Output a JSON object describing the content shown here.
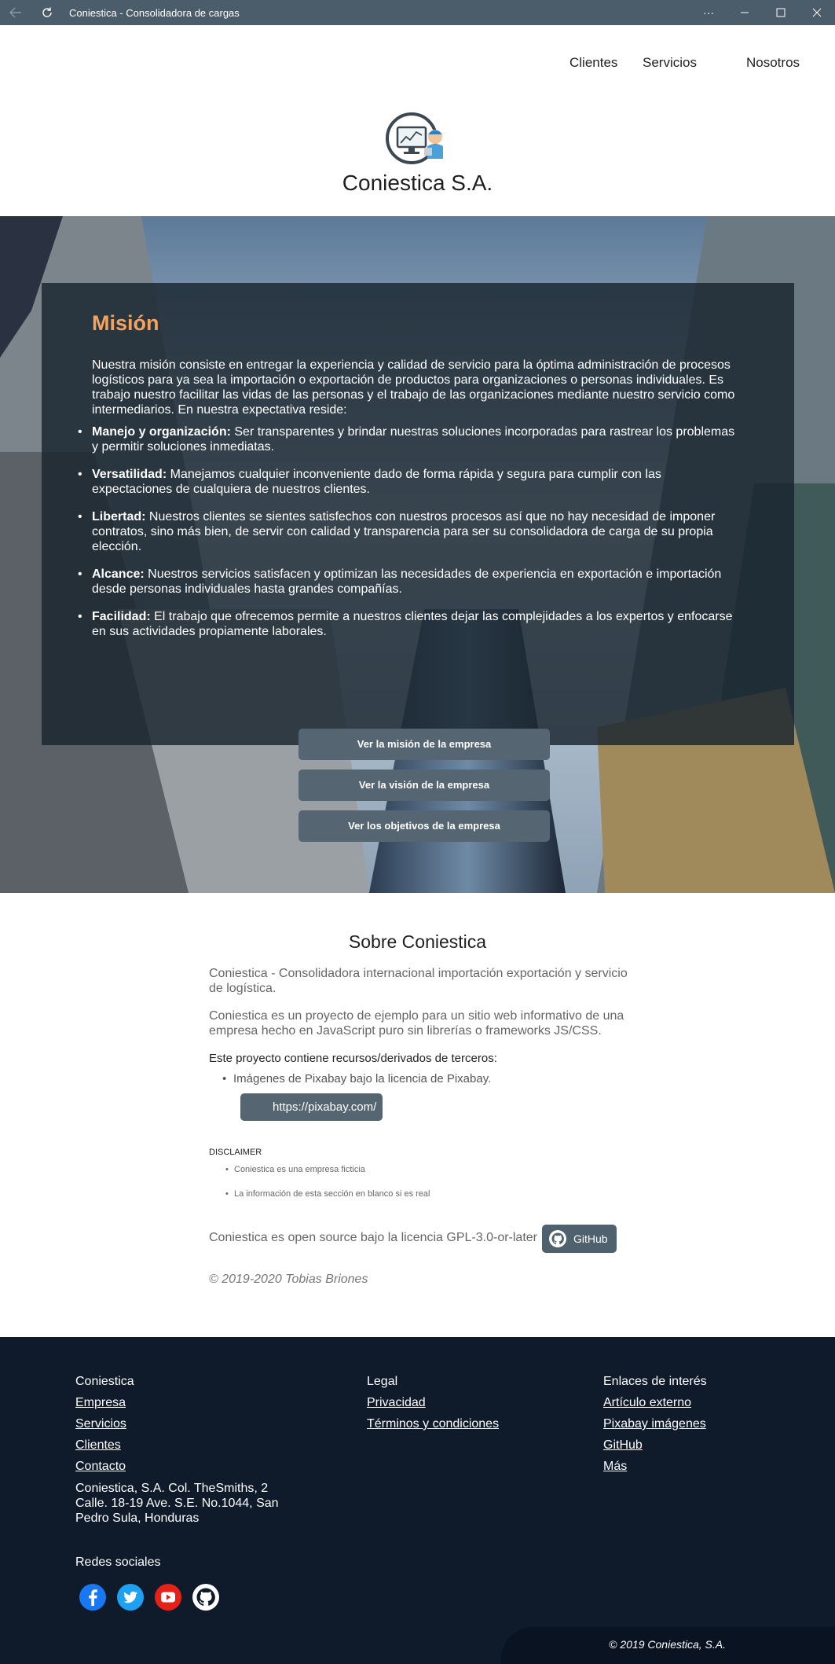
{
  "window": {
    "title": "Coniestica - Consolidadora de cargas",
    "more_label": "···",
    "minimize_label": "—",
    "maximize_label": "☐",
    "close_label": "✕"
  },
  "nav": {
    "clientes": "Clientes",
    "servicios": "Servicios",
    "nosotros": "Nosotros"
  },
  "brand": "Coniestica S.A.",
  "mission": {
    "title": "Misión",
    "intro": "Nuestra misión consiste en entregar la experiencia y calidad de servicio para la óptima administración de procesos logísticos para ya sea la importación o exportación de productos para organizaciones o personas individuales. Es trabajo nuestro facilitar las vidas de las personas y el trabajo de las organizaciones mediante nuestro servicio como intermediarios. En nuestra expectativa reside:",
    "items": [
      {
        "term": "Manejo y organización:",
        "text": " Ser transparentes y brindar nuestras soluciones incorporadas para rastrear los problemas y permitir soluciones inmediatas."
      },
      {
        "term": "Versatilidad:",
        "text": " Manejamos cualquier inconveniente dado de forma rápida y segura para cumplir con las expectaciones de cualquiera de nuestros clientes."
      },
      {
        "term": "Libertad:",
        "text": " Nuestros clientes se sientes satisfechos con nuestros procesos así que no hay necesidad de imponer contratos, sino más bien, de servir con calidad y transparencia para ser su consolidadora de carga de su propia elección."
      },
      {
        "term": "Alcance:",
        "text": " Nuestros servicios satisfacen y optimizan las necesidades de experiencia en exportación e importación desde personas individuales hasta grandes compañías."
      },
      {
        "term": "Facilidad:",
        "text": " El trabajo que ofrecemos permite a nuestros clientes dejar las complejidades a los expertos y enfocarse en sus actividades propiamente laborales."
      }
    ]
  },
  "hero_buttons": {
    "mision": "Ver la misión de la empresa",
    "vision": "Ver la visión de la empresa",
    "objetivos": "Ver los objetivos de la empresa"
  },
  "about": {
    "title": "Sobre Coniestica",
    "p1": "Coniestica - Consolidadora internacional importación exportación y servicio de logística.",
    "p2": "Coniestica es un proyecto de ejemplo para un sitio web informativo de una empresa hecho en JavaScript puro sin librerías o frameworks JS/CSS.",
    "resources_title": "Este proyecto contiene recursos/derivados de terceros:",
    "resources_item": "Imágenes de Pixabay bajo la licencia de Pixabay.",
    "pixabay_button": "https://pixabay.com/",
    "disclaimer_title": "DISCLAIMER",
    "disclaimer_1": "Coniestica es una empresa ficticia",
    "disclaimer_2": "La información de esta sección en blanco si es real",
    "opensource": "Coniestica es open source bajo la licencia GPL-3.0-or-later",
    "github_button": "GitHub",
    "copyright": "© 2019-2020 Tobias Briones"
  },
  "footer": {
    "col1_title": "Coniestica",
    "col1_links": [
      "Empresa",
      "Servicios",
      "Clientes",
      "Contacto"
    ],
    "address": "Coniestica, S.A. Col. TheSmiths, 2 Calle. 18-19 Ave. S.E. No.1044, San Pedro Sula, Honduras",
    "col2_title": "Legal",
    "col2_links": [
      "Privacidad",
      "Términos y condiciones"
    ],
    "col3_title": "Enlaces de interés",
    "col3_links": [
      "Artículo externo",
      "Pixabay imágenes",
      "GitHub",
      "Más"
    ],
    "social_title": "Redes sociales",
    "social_icons": [
      "facebook-icon",
      "twitter-icon",
      "youtube-icon",
      "github-icon"
    ],
    "copyright": "© 2019 Coniestica, S.A."
  },
  "colors": {
    "titlebar": "#4b5d6b",
    "accent_orange": "#f2a35f",
    "button": "#556672",
    "footer_bg": "#0f1a2b"
  }
}
